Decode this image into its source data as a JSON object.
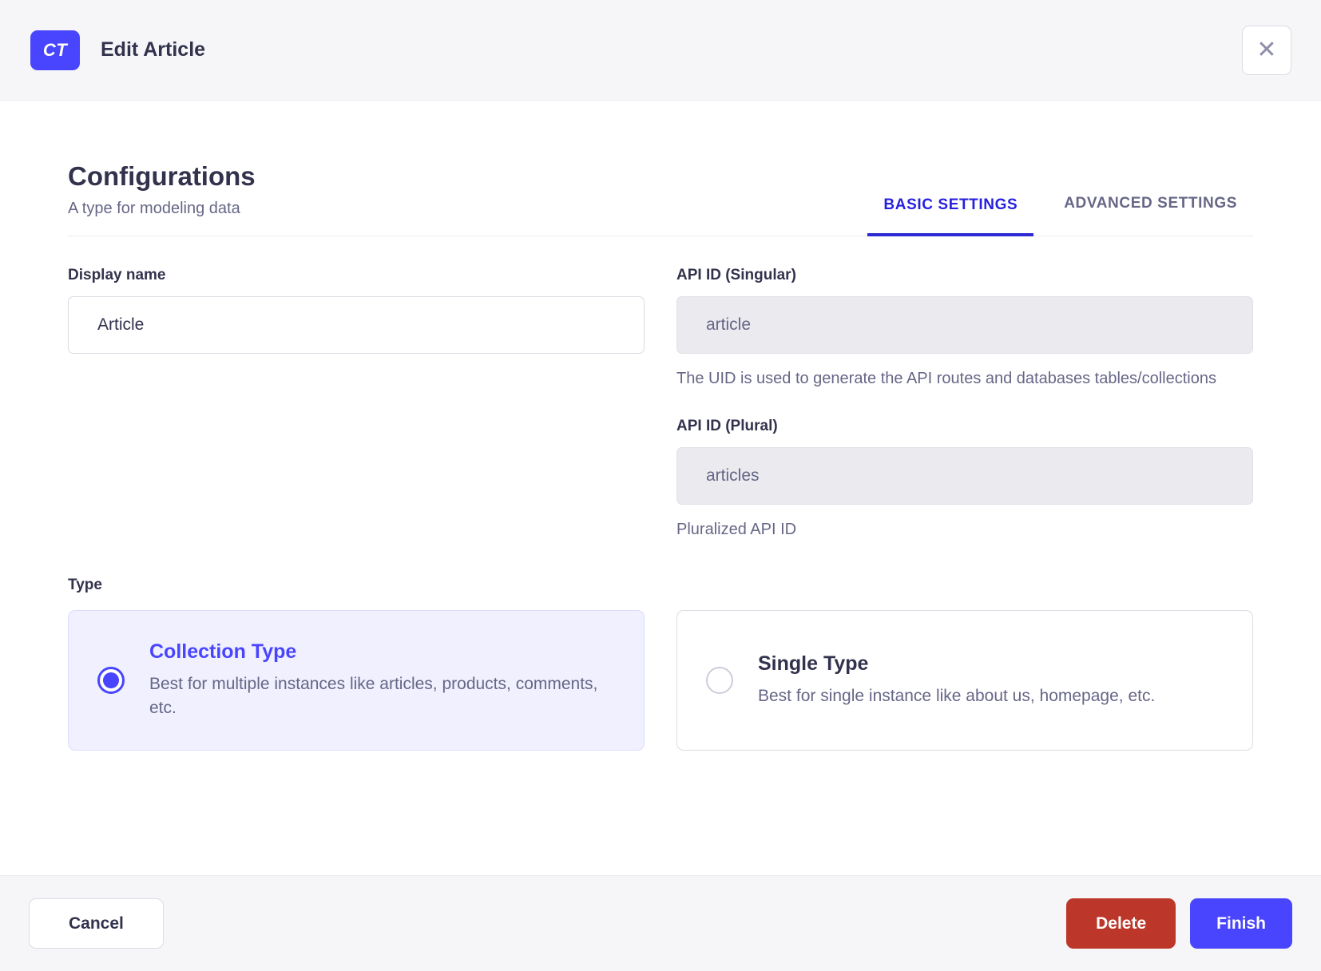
{
  "colors": {
    "primary": "#4945ff",
    "active_tab_blue": "#271fe0",
    "danger_red": "#bc372a",
    "text_dark": "#32324d",
    "text_muted": "#666687",
    "border": "#dcdce4",
    "surface_gray": "#f6f6f9",
    "disabled_input_bg": "#eaeaef",
    "selected_card_bg": "#f0f0ff"
  },
  "icons": {
    "close": "✕"
  },
  "header": {
    "badge": "CT",
    "title": "Edit Article"
  },
  "config": {
    "title": "Configurations",
    "subtitle": "A type for modeling data",
    "tabs": [
      {
        "label": "BASIC SETTINGS",
        "active": true
      },
      {
        "label": "ADVANCED SETTINGS",
        "active": false
      }
    ]
  },
  "form": {
    "display_name": {
      "label": "Display name",
      "value": "Article"
    },
    "api_id_singular": {
      "label": "API ID (Singular)",
      "value": "article",
      "hint": "The UID is used to generate the API routes and databases tables/collections"
    },
    "api_id_plural": {
      "label": "API ID (Plural)",
      "value": "articles",
      "hint": "Pluralized API ID"
    },
    "type": {
      "label": "Type",
      "options": [
        {
          "title": "Collection Type",
          "description": "Best for multiple instances like articles, products, comments, etc.",
          "selected": true
        },
        {
          "title": "Single Type",
          "description": "Best for single instance like about us, homepage, etc.",
          "selected": false
        }
      ]
    }
  },
  "footer": {
    "cancel": "Cancel",
    "delete": "Delete",
    "finish": "Finish"
  }
}
